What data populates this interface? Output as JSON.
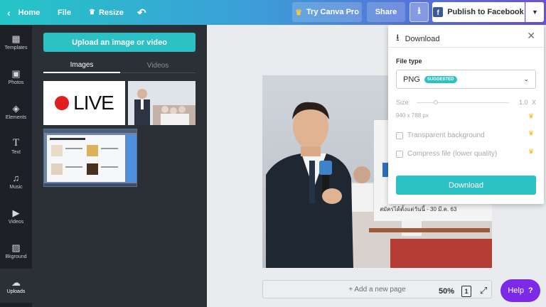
{
  "topbar": {
    "home": "Home",
    "file": "File",
    "resize": "Resize",
    "try_canva_pro": "Try Canva Pro",
    "share": "Share",
    "publish": "Publish to Facebook"
  },
  "rail": {
    "items": [
      {
        "label": "Templates",
        "icon": "templates-icon"
      },
      {
        "label": "Photos",
        "icon": "photos-icon"
      },
      {
        "label": "Elements",
        "icon": "elements-icon"
      },
      {
        "label": "Text",
        "icon": "text-icon"
      },
      {
        "label": "Music",
        "icon": "music-icon"
      },
      {
        "label": "Videos",
        "icon": "videos-icon"
      },
      {
        "label": "Bkground",
        "icon": "background-icon"
      },
      {
        "label": "Uploads",
        "icon": "uploads-icon"
      }
    ]
  },
  "panel": {
    "upload_button": "Upload an image or video",
    "tabs": [
      "Images",
      "Videos"
    ],
    "thumb_live_text": "LIVE"
  },
  "canvas": {
    "caption": "สมัครได้ตั้งแต่วันนี้ - 30 มี.ค. 63",
    "add_page": "+ Add a new page",
    "zoom": "50%",
    "page_number": "1",
    "help": "Help"
  },
  "download_panel": {
    "title": "Download",
    "file_type_label": "File type",
    "file_type_value": "PNG",
    "suggested_badge": "SUGGESTED",
    "size_label": "Size",
    "size_value": "1.0",
    "size_unit": "X",
    "dimensions": "940 x 788 px",
    "transparent_bg": "Transparent background",
    "compress": "Compress file (lower quality)",
    "download_button": "Download"
  },
  "colors": {
    "accent": "#2cc1c4",
    "pro_crown": "#f6b500",
    "help": "#7d2ae8",
    "facebook": "#3b5998"
  }
}
